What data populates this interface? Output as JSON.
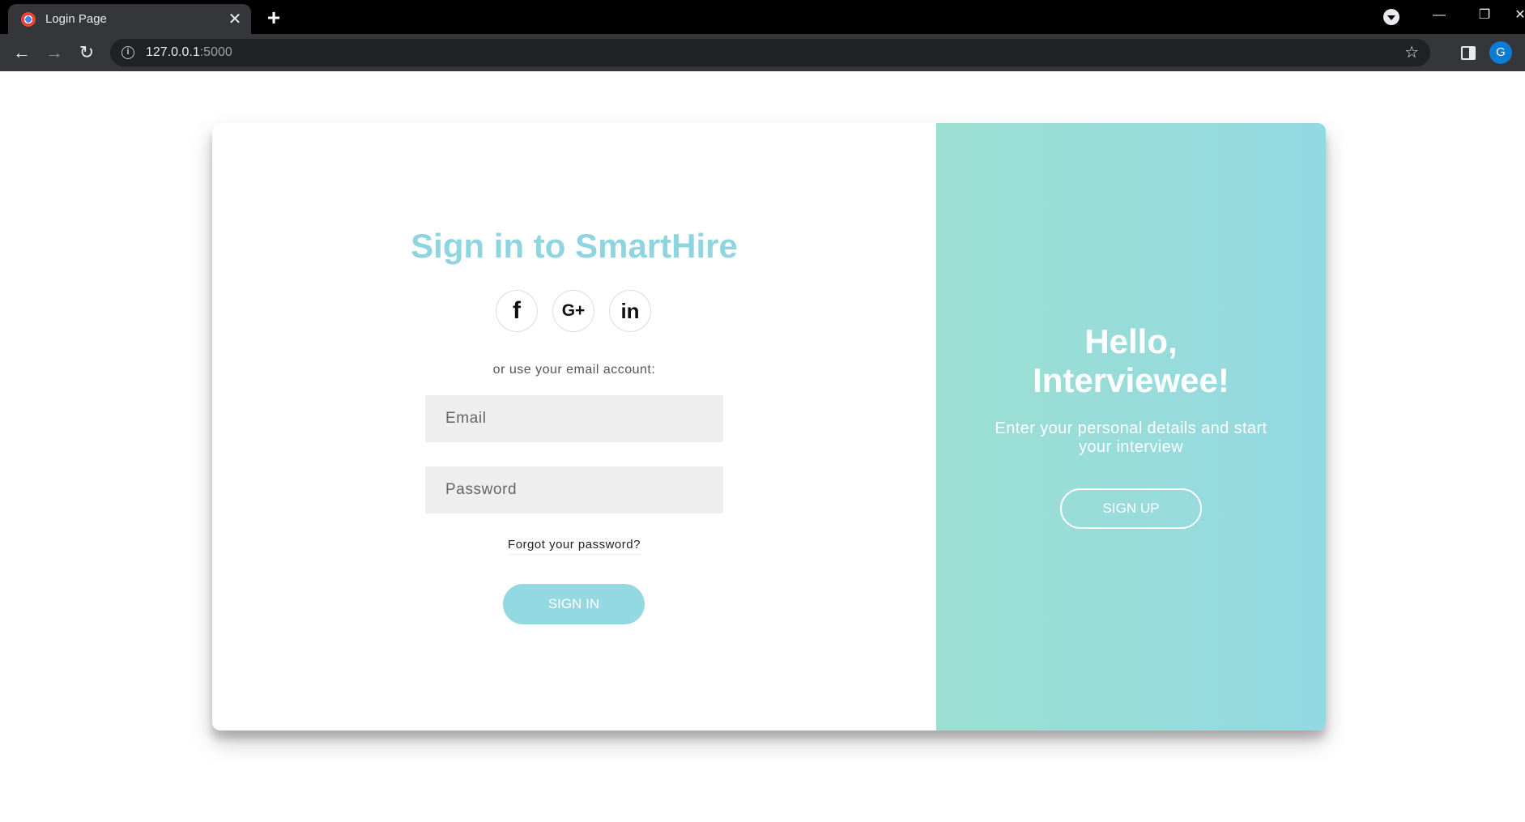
{
  "browser": {
    "tab_title": "Login Page",
    "tab_close": "✕",
    "new_tab": "+",
    "url_host": "127.0.0.1",
    "url_port": ":5000",
    "profile_initial": "G",
    "window_min": "—",
    "window_restore": "❐",
    "window_close": "✕"
  },
  "signin": {
    "title": "Sign in to SmartHire",
    "social": [
      {
        "icon": "facebook-icon",
        "glyph": "f"
      },
      {
        "icon": "google-plus-icon",
        "glyph": "G+"
      },
      {
        "icon": "linkedin-icon",
        "glyph": "in"
      }
    ],
    "alt_text": "or use your email account:",
    "email_placeholder": "Email",
    "password_placeholder": "Password",
    "forgot_label": "Forgot your password?",
    "button_label": "SIGN IN"
  },
  "overlay": {
    "title_line1": "Hello,",
    "title_line2": "Interviewee!",
    "subtitle": "Enter your personal details and start your interview",
    "button_label": "SIGN UP"
  },
  "colors": {
    "accent": "#8fd5e0",
    "overlay_gradient_start": "#9cdfd2",
    "overlay_gradient_end": "#94d9e2",
    "field_bg": "#eeeeee"
  }
}
